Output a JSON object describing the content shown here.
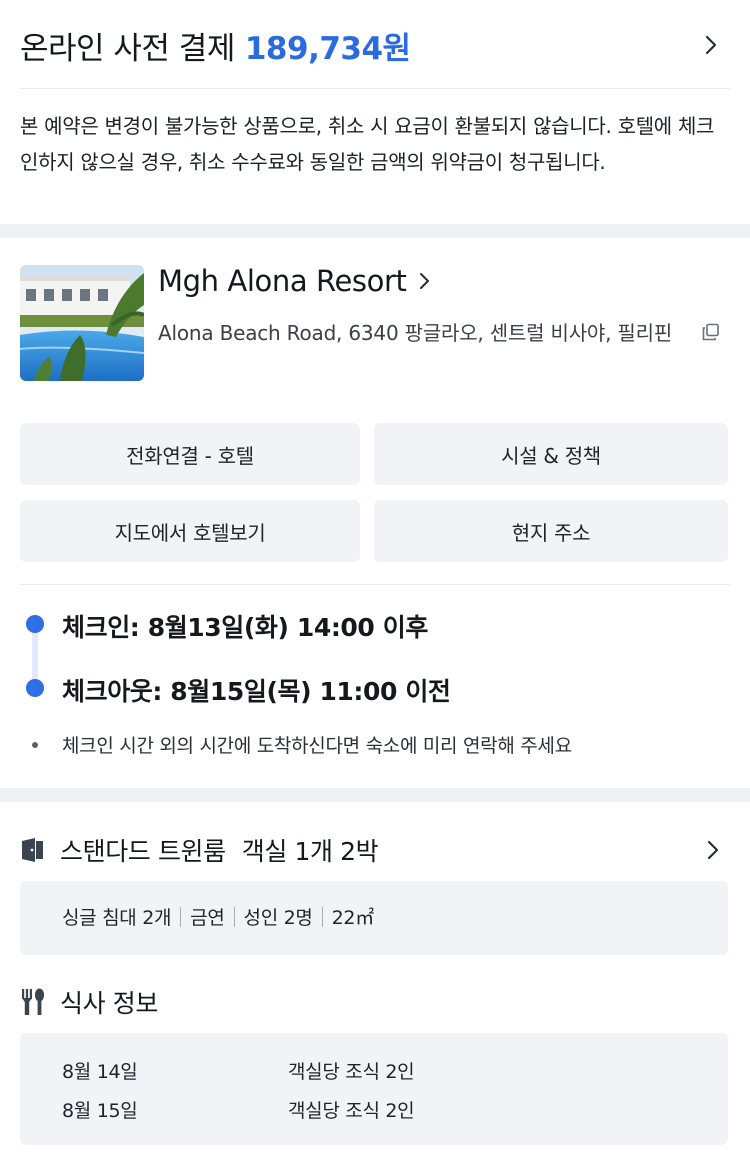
{
  "payment": {
    "title": "온라인 사전 결제",
    "amount": "189,734원",
    "notice": "본 예약은 변경이 불가능한 상품으로, 취소 시 요금이 환불되지 않습니다. 호텔에 체크인하지 않으실 경우, 취소 수수료와 동일한 금액의 위약금이 청구됩니다."
  },
  "hotel": {
    "name": "Mgh Alona Resort",
    "address": "Alona Beach Road, 6340 팡글라오, 센트럴 비사야, 필리핀",
    "buttons": {
      "call": "전화연결 - 호텔",
      "facilities": "시설 & 정책",
      "map": "지도에서 호텔보기",
      "local_address": "현지 주소"
    }
  },
  "stay": {
    "checkin": "체크인: 8월13일(화) 14:00 이후",
    "checkout": "체크아웃: 8월15일(목) 11:00 이전",
    "note": "체크인 시간 외의 시간에 도착하신다면 숙소에 미리 연락해 주세요"
  },
  "room": {
    "name": "스탠다드 트윈룸",
    "summary": "객실 1개 2박",
    "specs": [
      "싱글 침대 2개",
      "금연",
      "성인 2명",
      "22㎡"
    ]
  },
  "meal": {
    "title": "식사 정보",
    "rows": [
      {
        "date": "8월 14일",
        "desc": "객실당 조식 2인"
      },
      {
        "date": "8월 15일",
        "desc": "객실당 조식 2인"
      }
    ]
  },
  "colors": {
    "accent": "#2a6be0",
    "timeline_dot": "#2f6fe6",
    "button_bg": "#f2f3f6",
    "section_gap": "#eef0f3"
  },
  "icons": [
    "chevron-right-icon",
    "copy-icon",
    "door-icon",
    "utensils-icon"
  ]
}
